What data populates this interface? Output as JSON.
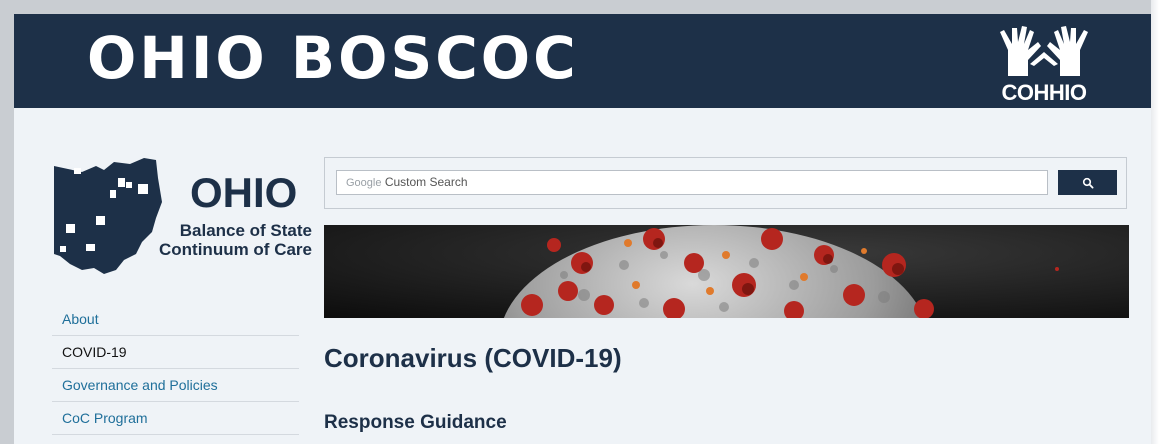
{
  "header": {
    "site_title": "OHIO BOSCOC",
    "partner_logo_text": "COHHIO",
    "background_color": "#1d3048"
  },
  "logo": {
    "name": "OHIO",
    "subtitle": "Balance of State\nContinuum of Care"
  },
  "search": {
    "brand": "Google",
    "placeholder": "Custom Search",
    "button_icon": "search-icon"
  },
  "hero": {
    "image": "coronavirus-illustration"
  },
  "nav": {
    "items": [
      {
        "label": "About",
        "active": false
      },
      {
        "label": "COVID-19",
        "active": true
      },
      {
        "label": "Governance and Policies",
        "active": false
      },
      {
        "label": "CoC Program",
        "active": false
      }
    ]
  },
  "main": {
    "title": "Coronavirus (COVID-19)",
    "section_heading": "Response Guidance"
  },
  "colors": {
    "accent": "#1d3048",
    "link": "#1f6f9a",
    "page_bg": "#eff3f7"
  }
}
